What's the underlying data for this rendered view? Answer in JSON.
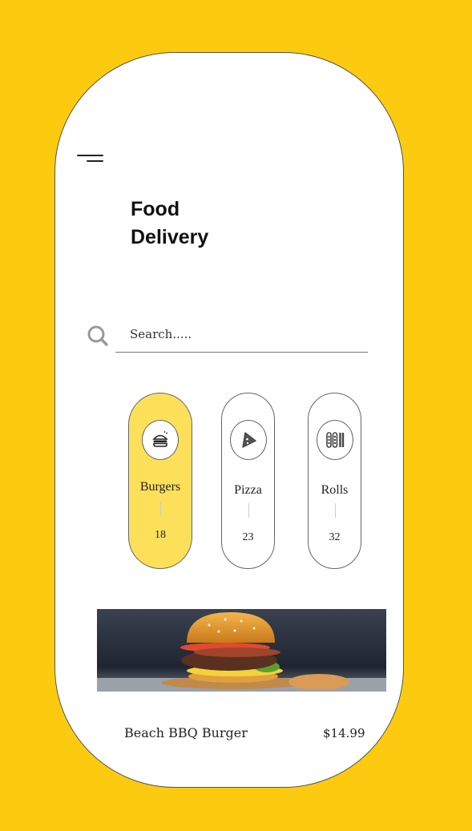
{
  "header": {
    "title_bold": "Food",
    "title_regular": "Delivery"
  },
  "search": {
    "placeholder": "Search....."
  },
  "categories": [
    {
      "label": "Burgers",
      "count": "18",
      "icon": "burger-icon",
      "active": true
    },
    {
      "label": "Pizza",
      "count": "23",
      "icon": "pizza-slice-icon",
      "active": false
    },
    {
      "label": "Rolls",
      "count": "32",
      "icon": "rolls-icon",
      "active": false
    }
  ],
  "featured": {
    "name": "Beach BBQ Burger",
    "price": "$14.99"
  },
  "colors": {
    "background": "#FCCB0F",
    "active_category": "#FDE05A",
    "card": "#ffffff"
  }
}
